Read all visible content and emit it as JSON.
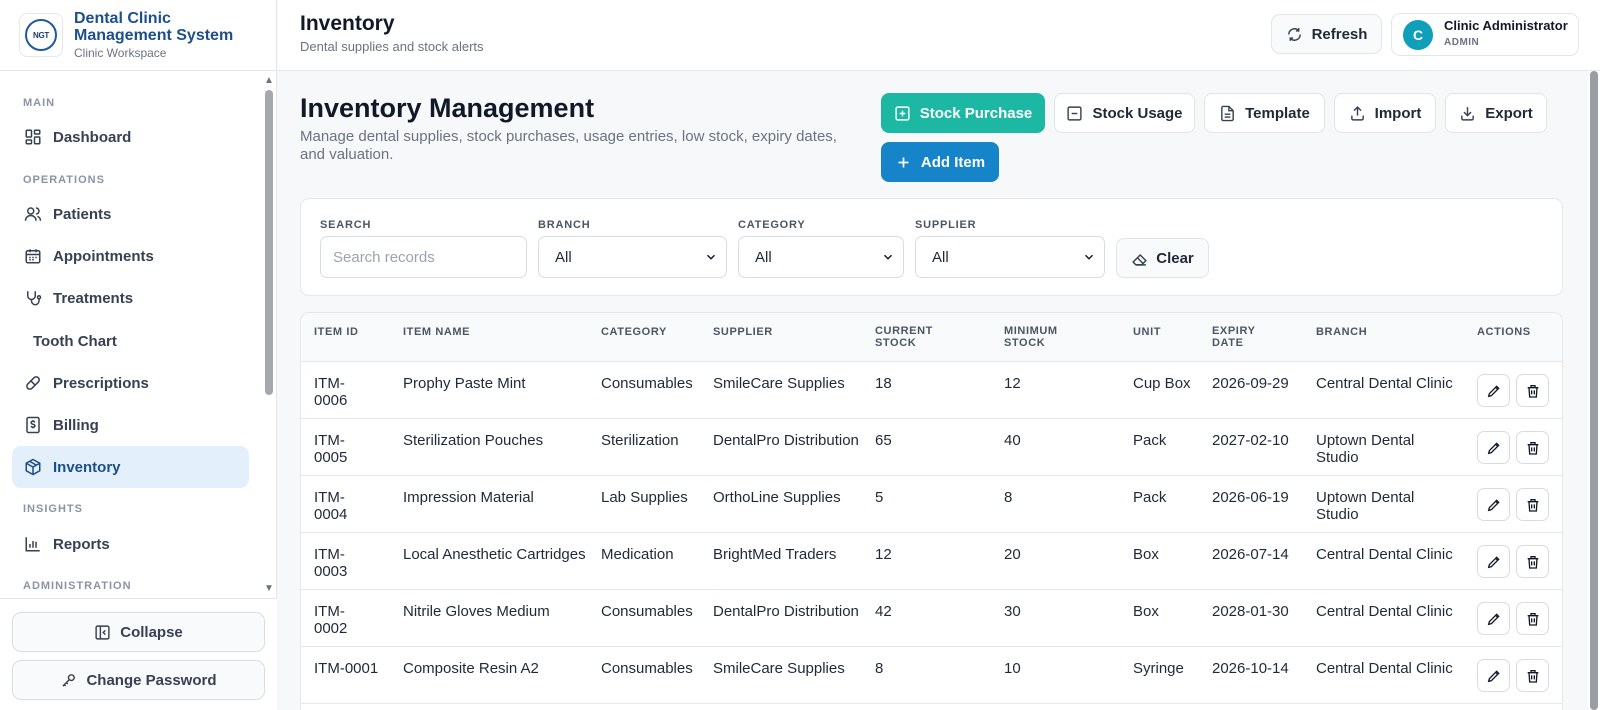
{
  "brand": {
    "title": "Dental Clinic Management System",
    "subtitle": "Clinic Workspace",
    "logo_text": "NGT"
  },
  "sidebar": {
    "sections": {
      "main": "MAIN",
      "operations": "OPERATIONS",
      "insights": "INSIGHTS",
      "administration": "ADMINISTRATION"
    },
    "items": {
      "dashboard": "Dashboard",
      "patients": "Patients",
      "appointments": "Appointments",
      "treatments": "Treatments",
      "tooth_chart": "Tooth Chart",
      "prescriptions": "Prescriptions",
      "billing": "Billing",
      "inventory": "Inventory",
      "reports": "Reports"
    },
    "active": "Inventory",
    "collapse": "Collapse",
    "change_password": "Change Password"
  },
  "topbar": {
    "title": "Inventory",
    "subtitle": "Dental supplies and stock alerts",
    "refresh": "Refresh",
    "user": {
      "initial": "C",
      "name": "Clinic Administrator",
      "role": "ADMIN"
    }
  },
  "page": {
    "title": "Inventory Management",
    "subtitle": "Manage dental supplies, stock purchases, usage entries, low stock, expiry dates, and valuation.",
    "actions": {
      "stock_purchase": "Stock Purchase",
      "stock_usage": "Stock Usage",
      "template": "Template",
      "import": "Import",
      "export": "Export",
      "add_item": "Add Item"
    }
  },
  "filters": {
    "search_label": "SEARCH",
    "search_placeholder": "Search records",
    "branch_label": "BRANCH",
    "branch_value": "All",
    "category_label": "CATEGORY",
    "category_value": "All",
    "supplier_label": "SUPPLIER",
    "supplier_value": "All",
    "clear": "Clear"
  },
  "table": {
    "headers": {
      "item_id": "ITEM ID",
      "item_name": "ITEM NAME",
      "category": "CATEGORY",
      "supplier": "SUPPLIER",
      "current_stock": "CURRENT STOCK",
      "minimum_stock": "MINIMUM STOCK",
      "unit": "UNIT",
      "expiry_date": "EXPIRY DATE",
      "branch": "BRANCH",
      "actions": "ACTIONS"
    },
    "rows": [
      {
        "id": "ITM-0006",
        "name": "Prophy Paste Mint",
        "category": "Consumables",
        "supplier": "SmileCare Supplies",
        "current": "18",
        "minimum": "12",
        "unit": "Cup Box",
        "expiry": "2026-09-29",
        "branch": "Central Dental Clinic"
      },
      {
        "id": "ITM-0005",
        "name": "Sterilization Pouches",
        "category": "Sterilization",
        "supplier": "DentalPro Distribution",
        "current": "65",
        "minimum": "40",
        "unit": "Pack",
        "expiry": "2027-02-10",
        "branch": "Uptown Dental Studio"
      },
      {
        "id": "ITM-0004",
        "name": "Impression Material",
        "category": "Lab Supplies",
        "supplier": "OrthoLine Supplies",
        "current": "5",
        "minimum": "8",
        "unit": "Pack",
        "expiry": "2026-06-19",
        "branch": "Uptown Dental Studio"
      },
      {
        "id": "ITM-0003",
        "name": "Local Anesthetic Cartridges",
        "category": "Medication",
        "supplier": "BrightMed Traders",
        "current": "12",
        "minimum": "20",
        "unit": "Box",
        "expiry": "2026-07-14",
        "branch": "Central Dental Clinic"
      },
      {
        "id": "ITM-0002",
        "name": "Nitrile Gloves Medium",
        "category": "Consumables",
        "supplier": "DentalPro Distribution",
        "current": "42",
        "minimum": "30",
        "unit": "Box",
        "expiry": "2028-01-30",
        "branch": "Central Dental Clinic"
      },
      {
        "id": "ITM-0001",
        "name": "Composite Resin A2",
        "category": "Consumables",
        "supplier": "SmileCare Supplies",
        "current": "8",
        "minimum": "10",
        "unit": "Syringe",
        "expiry": "2026-10-14",
        "branch": "Central Dental Clinic"
      }
    ]
  },
  "colors": {
    "accent_teal": "#1cb8a4",
    "accent_blue": "#1584c9",
    "active_nav_bg": "#e3f0fc",
    "brand_blue": "#1d4f8c"
  }
}
